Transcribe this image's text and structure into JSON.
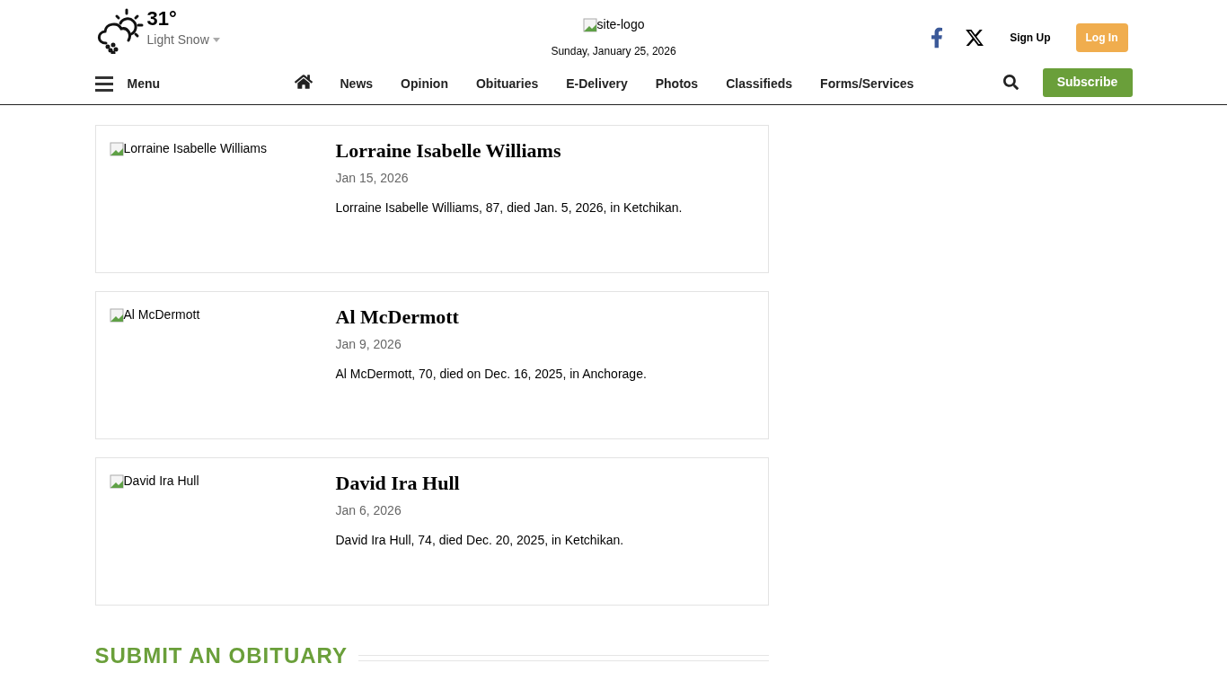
{
  "weather": {
    "temperature": "31°",
    "condition": "Light Snow"
  },
  "logo": {
    "alt": "site-logo"
  },
  "date": "Sunday, January 25, 2026",
  "account": {
    "sign_up": "Sign Up",
    "log_in": "Log In"
  },
  "menu": {
    "label": "Menu"
  },
  "nav": [
    "News",
    "Opinion",
    "Obituaries",
    "E-Delivery",
    "Photos",
    "Classifieds",
    "Forms/Services"
  ],
  "subscribe": "Subscribe",
  "obituaries": [
    {
      "image_alt": "Lorraine Isabelle Williams",
      "name": "Lorraine Isabelle Williams",
      "date": "Jan 15, 2026",
      "summary": "Lorraine Isabelle Williams, 87, died Jan. 5, 2026, in Ketchikan."
    },
    {
      "image_alt": "Al McDermott",
      "name": "Al McDermott",
      "date": "Jan 9, 2026",
      "summary": "Al McDermott, 70, died on Dec. 16, 2025, in Anchorage."
    },
    {
      "image_alt": "David Ira Hull",
      "name": "David Ira Hull",
      "date": "Jan 6, 2026",
      "summary": "David Ira Hull, 74, died Dec. 20, 2025, in Ketchikan."
    }
  ],
  "submit_heading": "SUBMIT AN OBITUARY"
}
